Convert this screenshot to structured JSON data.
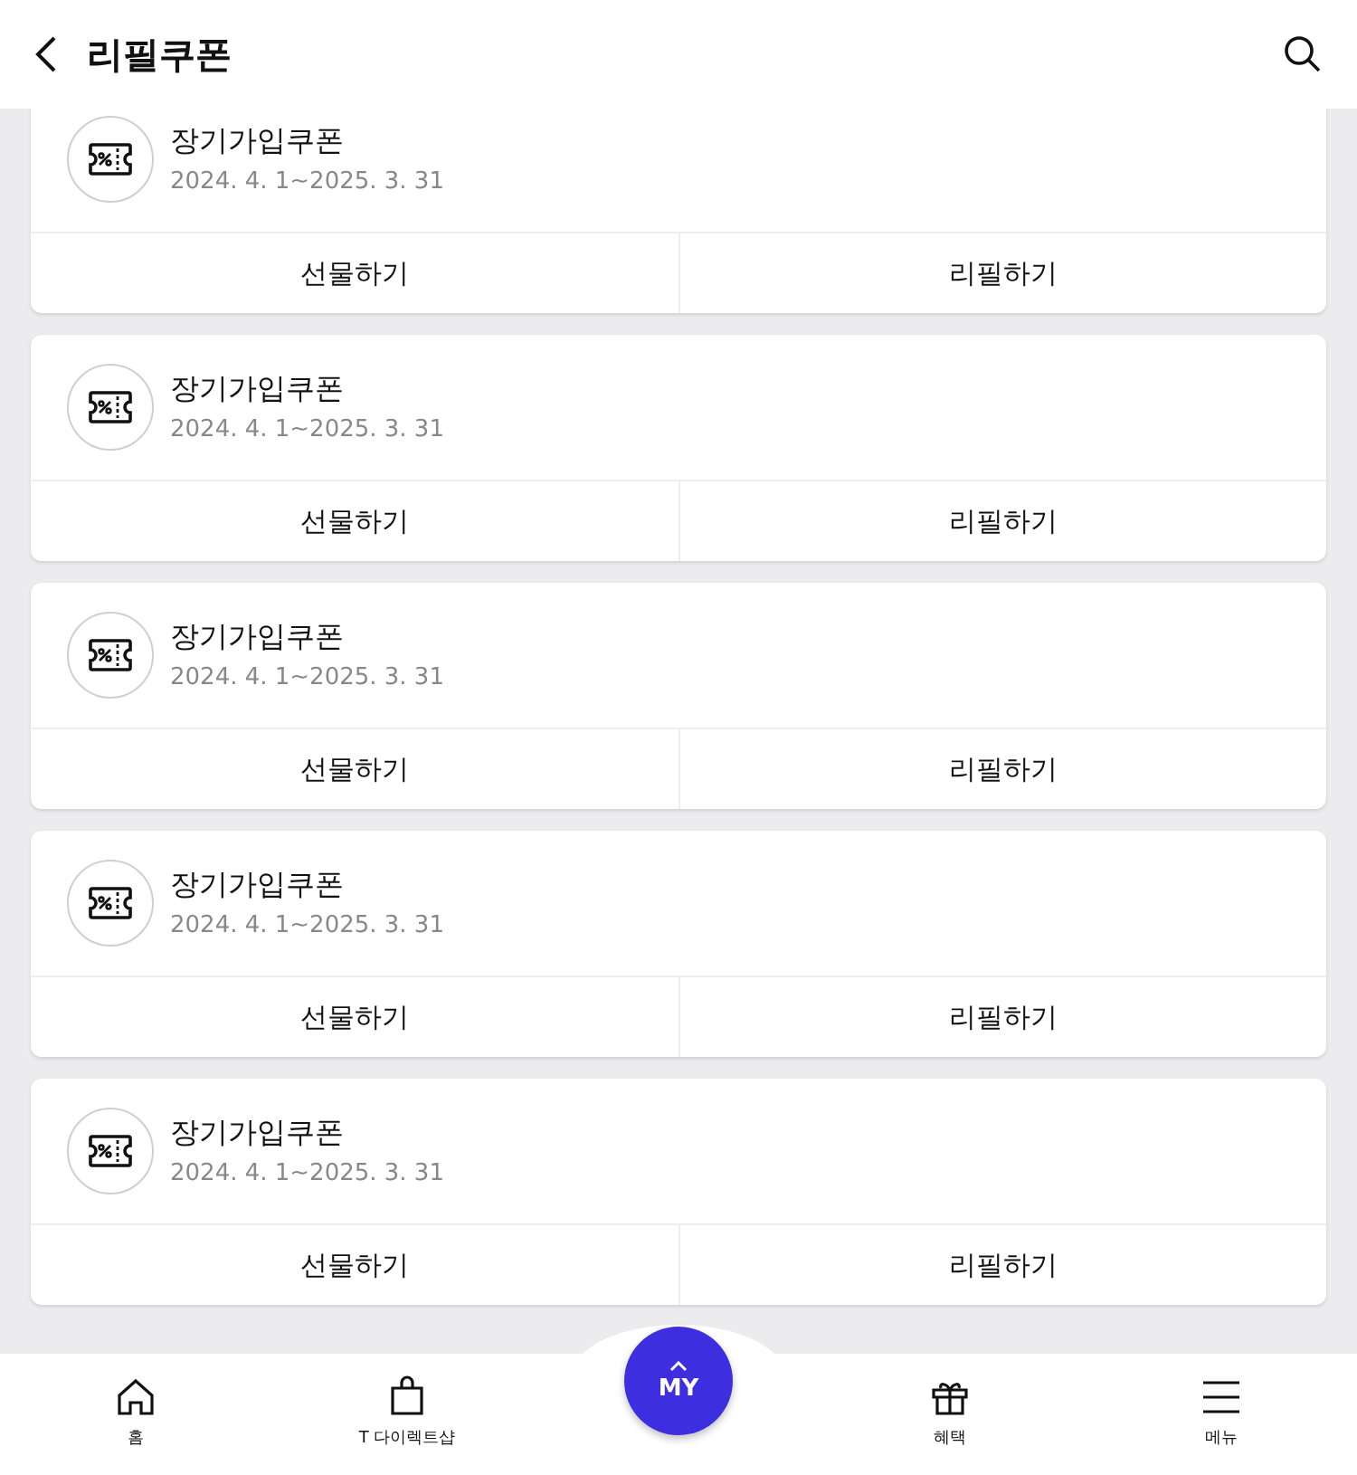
{
  "header": {
    "title": "리필쿠폰"
  },
  "coupons": [
    {
      "title": "장기가입쿠폰",
      "period": "2024. 4. 1~2025. 3. 31",
      "actions": [
        "선물하기",
        "리필하기"
      ]
    },
    {
      "title": "장기가입쿠폰",
      "period": "2024. 4. 1~2025. 3. 31",
      "actions": [
        "선물하기",
        "리필하기"
      ]
    },
    {
      "title": "장기가입쿠폰",
      "period": "2024. 4. 1~2025. 3. 31",
      "actions": [
        "선물하기",
        "리필하기"
      ]
    },
    {
      "title": "장기가입쿠폰",
      "period": "2024. 4. 1~2025. 3. 31",
      "actions": [
        "선물하기",
        "리필하기"
      ]
    },
    {
      "title": "장기가입쿠폰",
      "period": "2024. 4. 1~2025. 3. 31",
      "actions": [
        "선물하기",
        "리필하기"
      ]
    }
  ],
  "bottom_nav": [
    {
      "kind": "home",
      "label": "홈"
    },
    {
      "kind": "shop",
      "label": "T 다이렉트샵"
    },
    {
      "kind": "my",
      "label": "MY"
    },
    {
      "kind": "gift",
      "label": "혜택"
    },
    {
      "kind": "menu",
      "label": "메뉴"
    }
  ]
}
